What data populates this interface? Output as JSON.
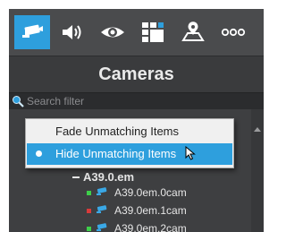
{
  "toolbar": {
    "buttons": [
      {
        "icon": "camera-icon",
        "active": true
      },
      {
        "icon": "speaker-icon",
        "active": false
      },
      {
        "icon": "eye-icon",
        "active": false
      },
      {
        "icon": "layout-grid-icon",
        "active": false
      },
      {
        "icon": "map-pin-icon",
        "active": false
      },
      {
        "icon": "more-dots-icon",
        "active": false
      }
    ]
  },
  "header": {
    "title": "Cameras"
  },
  "search": {
    "placeholder": "Search filter",
    "value": ""
  },
  "menu": {
    "items": [
      {
        "label": "Fade Unmatching Items",
        "selected": false
      },
      {
        "label": "Hide Unmatching Items",
        "selected": true
      }
    ]
  },
  "tree": {
    "group_label": "A39.0.em",
    "cameras": [
      {
        "label": "A39.0em.0cam",
        "status": "green"
      },
      {
        "label": "A39.0em.1cam",
        "status": "red"
      },
      {
        "label": "A39.0em.2cam",
        "status": "green"
      }
    ]
  },
  "colors": {
    "accent": "#2e9fdd",
    "status_green": "#3ecf4a",
    "status_red": "#d83a3a",
    "panel_bg": "#3e3f41"
  }
}
